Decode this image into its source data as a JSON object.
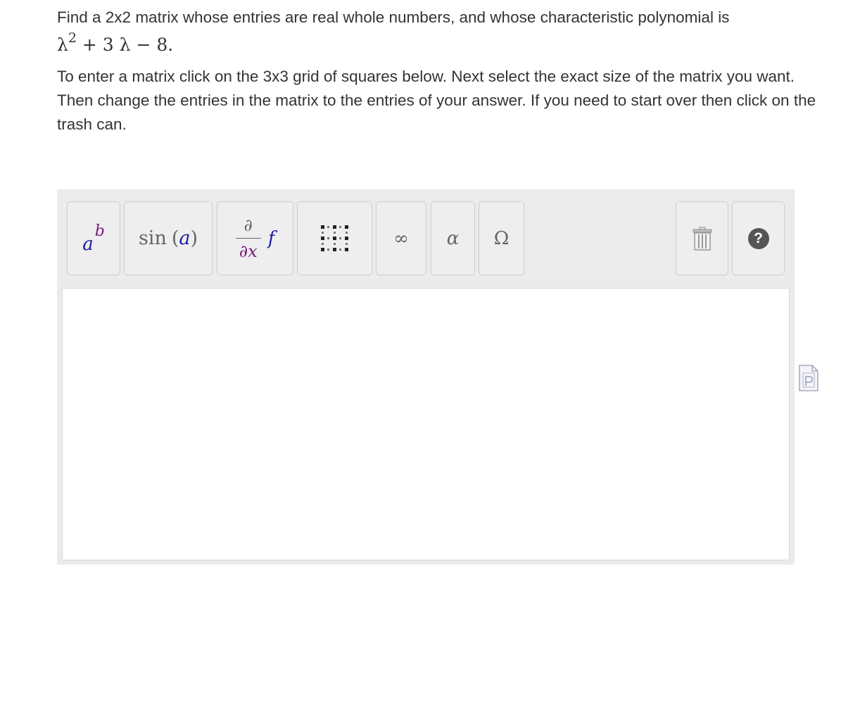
{
  "question": {
    "line1": "Find a 2x2 matrix whose entries are real whole numbers, and whose characteristic polynomial is",
    "poly_base": "λ",
    "poly_exp": "2",
    "poly_rest": " + 3 λ − 8.",
    "instr1": "To enter a matrix click on the 3x3 grid of squares below. Next select the exact size of the matrix you want.",
    "instr2": "Then change the entries in the matrix to the entries of your answer. If you need to start over then click on the trash can."
  },
  "toolbar": {
    "power": {
      "base": "a",
      "exp": "b"
    },
    "trig": {
      "fn": "sin",
      "open": "(",
      "arg": "a",
      "close": ")"
    },
    "derivative": {
      "num": "∂",
      "den": "∂x",
      "func": "f"
    },
    "infinity": "∞",
    "alpha": "α",
    "omega": "Ω",
    "help": "?"
  },
  "answer": {
    "value": ""
  },
  "colors": {
    "toolbar_bg": "#ebebeb",
    "button_bg": "#eeeeee",
    "button_border": "#cdcdcd",
    "var_a": "#1a1aa6",
    "var_b": "#7a1a7a",
    "help_circle": "#555555"
  }
}
